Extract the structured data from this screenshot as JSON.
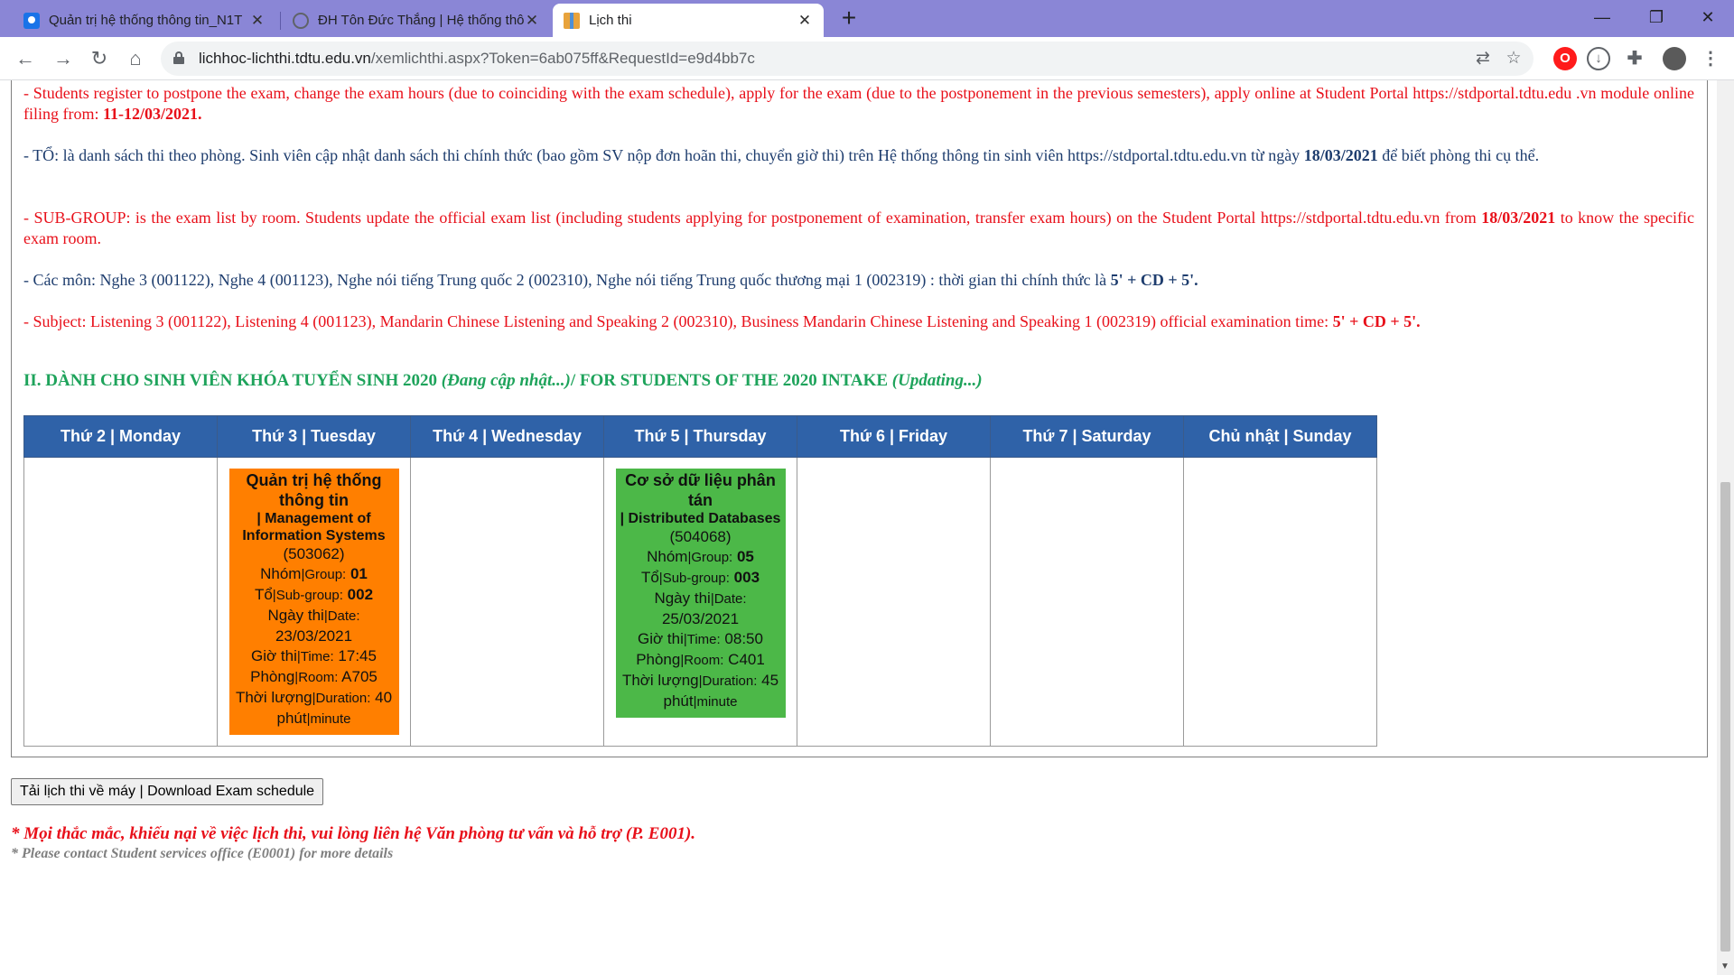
{
  "browser": {
    "tabs": [
      {
        "title": "Quản trị hệ thống thông tin_N1T",
        "favicon": "contacts-icon"
      },
      {
        "title": "ĐH Tôn Đức Thắng | Hệ thống thông",
        "favicon": "globe-icon"
      },
      {
        "title": "Lịch thi",
        "favicon": "gift-icon"
      }
    ],
    "url_domain": "lichhoc-lichthi.tdtu.edu.vn",
    "url_path": "/xemlichthi.aspx?Token=6ab075ff&RequestId=e9d4bb7c"
  },
  "notices": {
    "en_postpone": "- Students register to postpone the exam, change the exam hours (due to coinciding with the exam schedule), apply for the exam (due to the postponement in the previous semesters), apply online at Student Portal https://stdportal.tdtu.edu .vn module online filing from: ",
    "en_postpone_date": "11-12/03/2021.",
    "vn_to_a": "- TỔ: là danh sách thi theo phòng. Sinh viên cập nhật danh sách thi chính thức (bao gồm SV nộp đơn hoãn thi, chuyển giờ thi) trên  Hệ thống thông tin sinh viên https://stdportal.tdtu.edu.vn từ ngày ",
    "vn_to_date": "18/03/2021",
    "vn_to_b": " để biết phòng thi cụ thể.",
    "en_subgroup_a": "- SUB-GROUP: is the exam list by room. Students update the official exam list (including students applying for postponement of examination, transfer exam hours) on the Student Portal https://stdportal.tdtu.edu.vn from ",
    "en_subgroup_date": "18/03/2021",
    "en_subgroup_b": " to know the specific exam room.",
    "vn_subjects": "- Các môn: Nghe 3 (001122), Nghe 4 (001123), Nghe nói tiếng Trung quốc 2 (002310), Nghe nói tiếng Trung quốc thương mại 1 (002319) : thời gian thi chính thức là ",
    "vn_subjects_time": "5' + CD + 5'.",
    "en_subjects": "- Subject: Listening 3 (001122), Listening 4 (001123), Mandarin Chinese Listening and Speaking 2 (002310), Business Mandarin Chinese Listening and Speaking 1 (002319) official examination time: ",
    "en_subjects_time": "5' + CD + 5'."
  },
  "section": {
    "title_a": "II. DÀNH CHO SINH VIÊN KHÓA TUYỂN SINH 2020 ",
    "title_b": "(Đang cập nhật...)",
    "title_c": "/ FOR STUDENTS OF THE 2020 INTAKE ",
    "title_d": "(Updating...)"
  },
  "schedule": {
    "days": [
      "Thứ 2 | Monday",
      "Thứ 3 | Tuesday",
      "Thứ 4 | Wednesday",
      "Thứ 5 | Thursday",
      "Thứ 6 | Friday",
      "Thứ 7 | Saturday",
      "Chủ nhật | Sunday"
    ],
    "exams": [
      {
        "name_vn": "Quản trị hệ thống thông tin",
        "name_en": "| Management of Information Systems",
        "code": "(503062)",
        "group_label": "Nhóm",
        "group_label_en": "|Group:",
        "group": "01",
        "subgroup_label": "Tổ",
        "subgroup_label_en": "|Sub-group:",
        "subgroup": "002",
        "date_label": "Ngày thi",
        "date_label_en": "|Date:",
        "date": "23/03/2021",
        "time_label": "Giờ thi",
        "time_label_en": "|Time:",
        "time": "17:45",
        "room_label": "Phòng",
        "room_label_en": "|Room:",
        "room": "A705",
        "duration_label": "Thời lượng",
        "duration_label_en": "|Duration:",
        "duration": "40",
        "unit": "phút",
        "unit_en": "|minute",
        "color": "#ff7f00"
      },
      {
        "name_vn": "Cơ sở dữ liệu phân tán",
        "name_en": "| Distributed Databases",
        "code": "(504068)",
        "group_label": "Nhóm",
        "group_label_en": "|Group:",
        "group": "05",
        "subgroup_label": "Tổ",
        "subgroup_label_en": "|Sub-group:",
        "subgroup": "003",
        "date_label": "Ngày thi",
        "date_label_en": "|Date:",
        "date": "25/03/2021",
        "time_label": "Giờ thi",
        "time_label_en": "|Time:",
        "time": "08:50",
        "room_label": "Phòng",
        "room_label_en": "|Room:",
        "room": "C401",
        "duration_label": "Thời lượng",
        "duration_label_en": "|Duration:",
        "duration": "45",
        "unit": "phút",
        "unit_en": "|minute",
        "color": "#4cb848"
      }
    ]
  },
  "download_button": "Tải lịch thi về máy | Download Exam schedule",
  "contact_note_vn": "* Mọi thắc mắc, khiếu nại về việc lịch thi, vui lòng liên hệ Văn phòng tư vấn và hỗ trợ (P. E001).",
  "contact_note_en": "* Please contact Student services office (E0001) for more details"
}
